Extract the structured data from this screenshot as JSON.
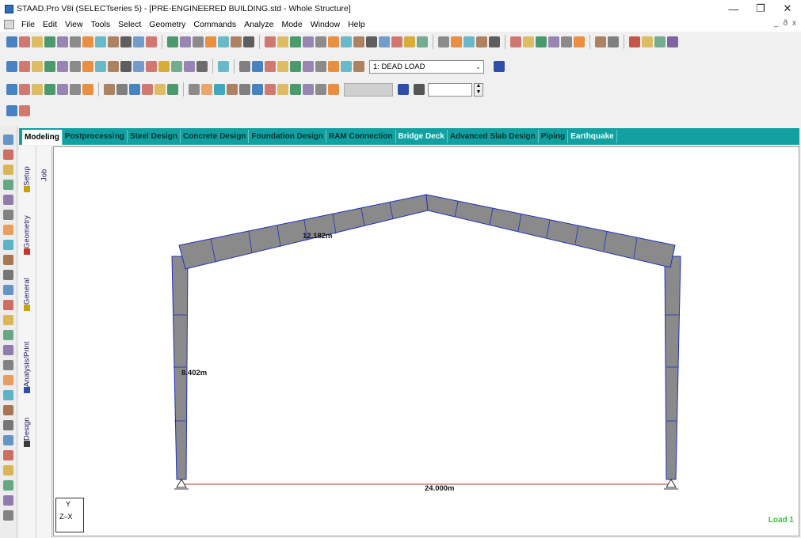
{
  "window": {
    "title": "STAAD.Pro V8i (SELECTseries 5) - [PRE-ENGINEERED BUILDING.std - Whole Structure]",
    "minimize": "—",
    "restore": "❐",
    "close": "✕"
  },
  "menu": {
    "items": [
      "File",
      "Edit",
      "View",
      "Tools",
      "Select",
      "Geometry",
      "Commands",
      "Analyze",
      "Mode",
      "Window",
      "Help"
    ],
    "mdi_controls": [
      "_",
      "ð",
      "x"
    ]
  },
  "toolbar": {
    "load_case": "1: DEAD LOAD",
    "caret": "⌄"
  },
  "tabs": {
    "items": [
      "Modeling",
      "Postprocessing",
      "Steel Design",
      "Concrete Design",
      "Foundation Design",
      "RAM Connection",
      "Bridge Deck",
      "Advanced Slab Design",
      "Piping",
      "Earthquake"
    ],
    "active": "Modeling"
  },
  "side_tabs": {
    "outer": [
      "Setup",
      "Geometry",
      "General",
      "Analysis/Print",
      "Design"
    ],
    "inner": [
      "Job"
    ]
  },
  "dimensions": {
    "rafter": "12.182m",
    "column": "8.402m",
    "span": "24.000m"
  },
  "axis": {
    "y": "Y",
    "zx": "Z–X"
  },
  "status": {
    "load": "Load 1"
  },
  "colors": {
    "tab_bar": "#12a0a0",
    "member_fill": "#8a8a8a",
    "member_outline": "#1f2fbf",
    "dimension_line": "#c0392b",
    "load_text": "#3cc43c"
  }
}
